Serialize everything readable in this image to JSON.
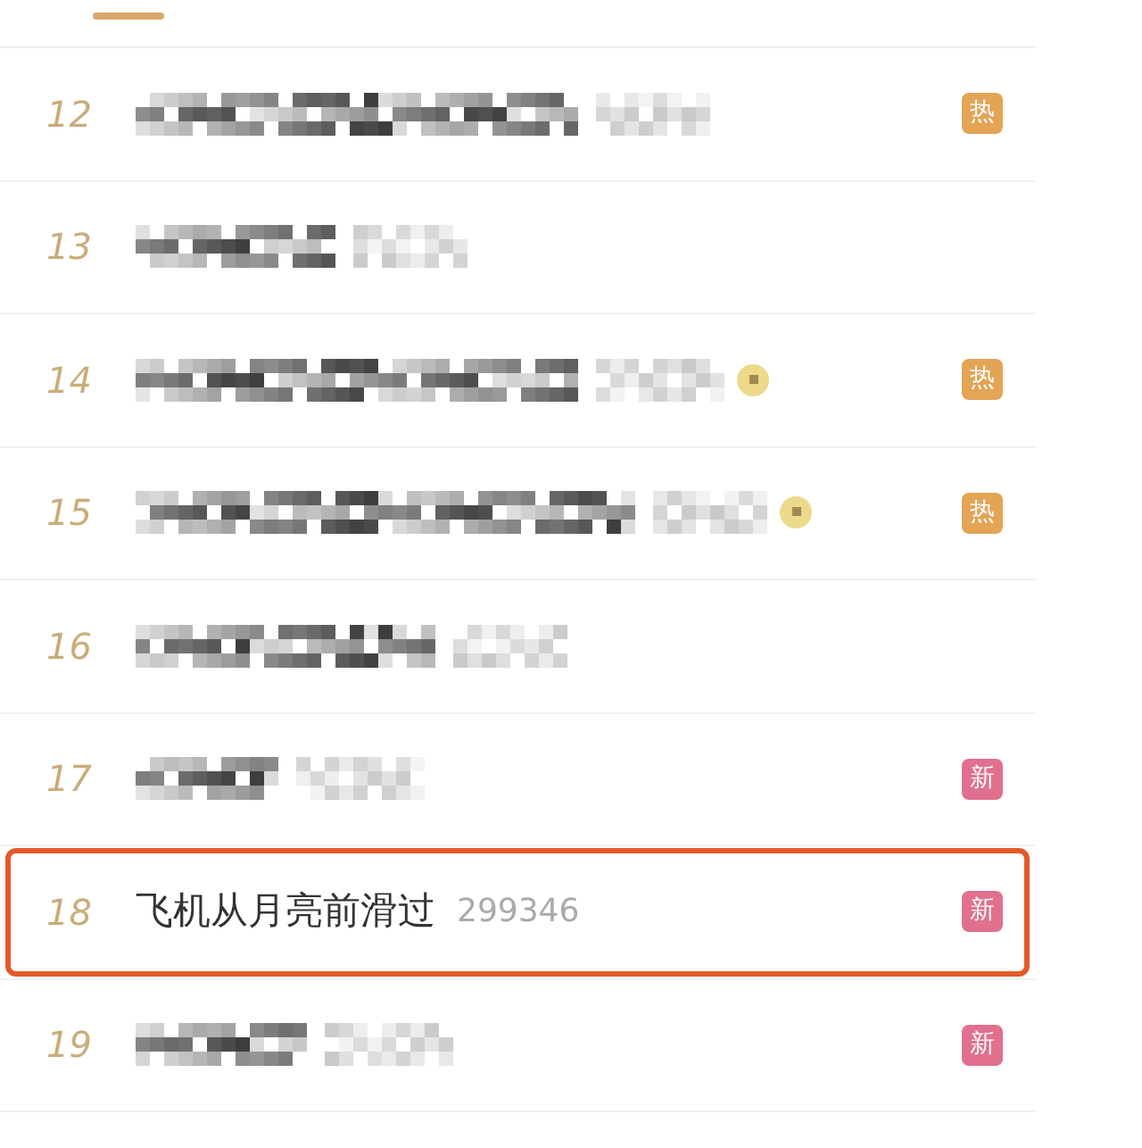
{
  "rows": [
    {
      "rank": "12",
      "kind": "blurred",
      "emoji": false,
      "badge": {
        "label": "热",
        "color": "#e3a455"
      },
      "highlighted": false
    },
    {
      "rank": "13",
      "kind": "blurred",
      "emoji": false,
      "highlighted": false
    },
    {
      "rank": "14",
      "kind": "blurred",
      "emoji": true,
      "badge": {
        "label": "热",
        "color": "#e3a455"
      },
      "highlighted": false
    },
    {
      "rank": "15",
      "kind": "blurred",
      "emoji": true,
      "badge": {
        "label": "热",
        "color": "#e3a455"
      },
      "highlighted": false
    },
    {
      "rank": "16",
      "kind": "blurred",
      "emoji": false,
      "highlighted": false
    },
    {
      "rank": "17",
      "kind": "blurred",
      "emoji": false,
      "badge": {
        "label": "新",
        "color": "#e0708e"
      },
      "highlighted": false
    },
    {
      "rank": "18",
      "kind": "text",
      "title": "飞机从月亮前滑过",
      "count": "299346",
      "emoji": false,
      "badge": {
        "label": "新",
        "color": "#e0708e"
      },
      "highlighted": true
    },
    {
      "rank": "19",
      "kind": "blurred",
      "emoji": false,
      "badge": {
        "label": "新",
        "color": "#e0708e"
      },
      "highlighted": false
    }
  ]
}
